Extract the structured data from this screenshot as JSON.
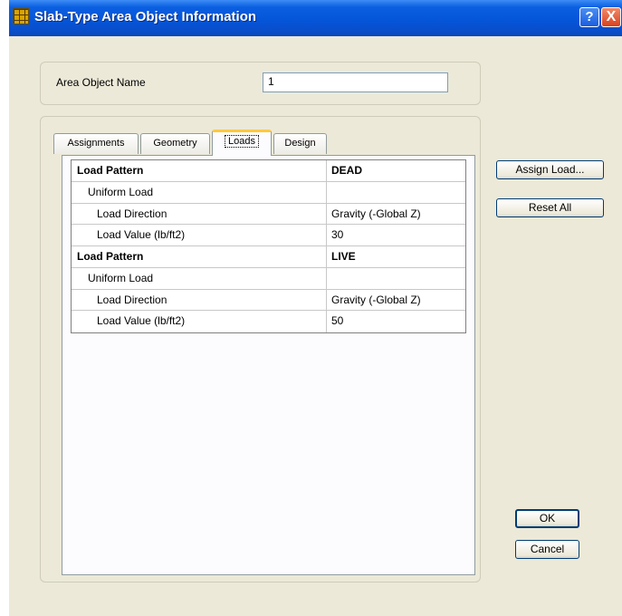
{
  "window": {
    "title": "Slab-Type Area Object Information",
    "help_glyph": "?",
    "close_glyph": "X"
  },
  "name_group": {
    "label": "Area Object Name",
    "value": "1"
  },
  "tabs": [
    {
      "label": "Assignments",
      "active": false
    },
    {
      "label": "Geometry",
      "active": false
    },
    {
      "label": "Loads",
      "active": true
    },
    {
      "label": "Design",
      "active": false
    }
  ],
  "loads_table": {
    "rows": [
      {
        "item": "Load Pattern",
        "value": "DEAD",
        "level": 0
      },
      {
        "item": "Uniform Load",
        "value": "",
        "level": 1
      },
      {
        "item": "Load Direction",
        "value": "Gravity (-Global Z)",
        "level": 2
      },
      {
        "item": "Load Value  (lb/ft2)",
        "value": "30",
        "level": 2
      },
      {
        "item": "Load Pattern",
        "value": "LIVE",
        "level": 0
      },
      {
        "item": "Uniform Load",
        "value": "",
        "level": 1
      },
      {
        "item": "Load Direction",
        "value": "Gravity (-Global Z)",
        "level": 2
      },
      {
        "item": "Load Value  (lb/ft2)",
        "value": "50",
        "level": 2
      }
    ]
  },
  "buttons": {
    "assign_load": "Assign Load...",
    "reset_all": "Reset All",
    "ok": "OK",
    "cancel": "Cancel"
  },
  "colors": {
    "titlebar": "#0554d8",
    "dialog_bg": "#ece9d8",
    "active_tab_highlight": "#ffc83c"
  }
}
